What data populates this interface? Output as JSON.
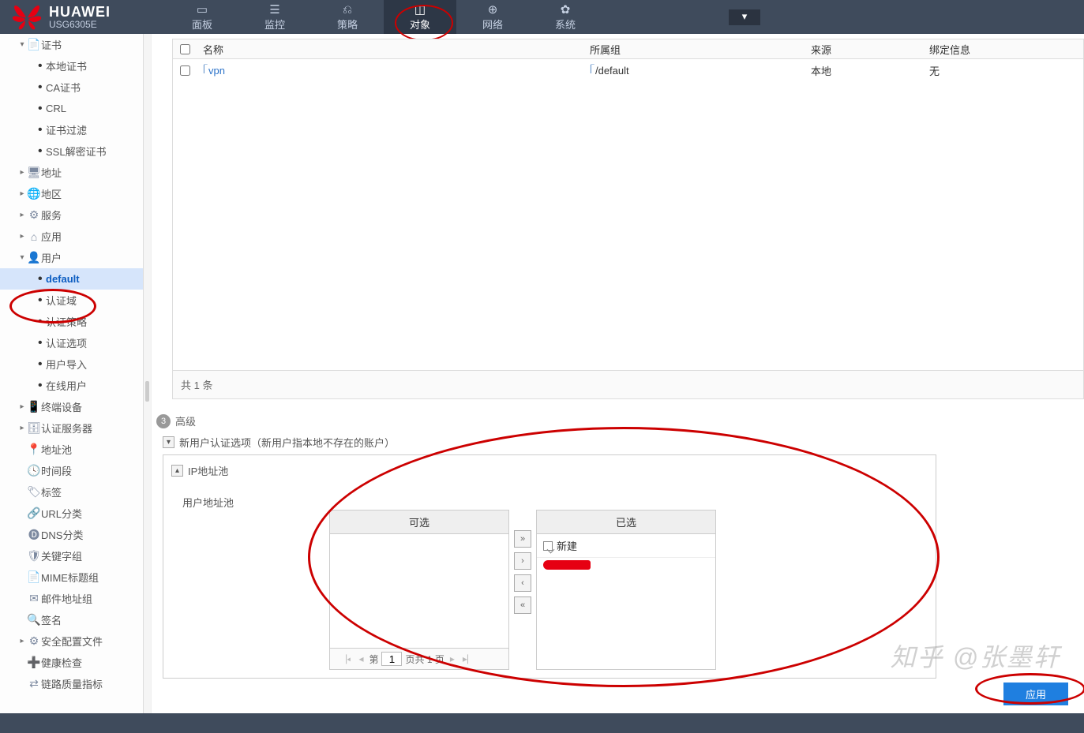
{
  "brand": {
    "name": "HUAWEI",
    "model": "USG6305E"
  },
  "navtabs": [
    {
      "id": "dashboard",
      "label": "面板",
      "icon": "▭"
    },
    {
      "id": "monitor",
      "label": "监控",
      "icon": "☰"
    },
    {
      "id": "policy",
      "label": "策略",
      "icon": "⎌"
    },
    {
      "id": "object",
      "label": "对象",
      "icon": "◫",
      "active": true
    },
    {
      "id": "network",
      "label": "网络",
      "icon": "⊕"
    },
    {
      "id": "system",
      "label": "系统",
      "icon": "✿"
    }
  ],
  "sidebar": [
    {
      "label": "证书",
      "lvl": 0,
      "open": true,
      "icon": "📄"
    },
    {
      "label": "本地证书",
      "lvl": 2
    },
    {
      "label": "CA证书",
      "lvl": 2
    },
    {
      "label": "CRL",
      "lvl": 2
    },
    {
      "label": "证书过滤",
      "lvl": 2
    },
    {
      "label": "SSL解密证书",
      "lvl": 2
    },
    {
      "label": "地址",
      "lvl": 0,
      "closed": true,
      "icon": "🖥"
    },
    {
      "label": "地区",
      "lvl": 0,
      "closed": true,
      "icon": "🌐"
    },
    {
      "label": "服务",
      "lvl": 0,
      "closed": true,
      "icon": "⚙"
    },
    {
      "label": "应用",
      "lvl": 0,
      "closed": true,
      "icon": "⌂"
    },
    {
      "label": "用户",
      "lvl": 0,
      "open": true,
      "icon": "👤"
    },
    {
      "label": "default",
      "lvl": 2,
      "selected": true
    },
    {
      "label": "认证域",
      "lvl": 2
    },
    {
      "label": "认证策略",
      "lvl": 2
    },
    {
      "label": "认证选项",
      "lvl": 2
    },
    {
      "label": "用户导入",
      "lvl": 2
    },
    {
      "label": "在线用户",
      "lvl": 2
    },
    {
      "label": "终端设备",
      "lvl": 0,
      "closed": true,
      "icon": "📱"
    },
    {
      "label": "认证服务器",
      "lvl": 0,
      "closed": true,
      "icon": "🗄"
    },
    {
      "label": "地址池",
      "lvl": 0,
      "leaf": true,
      "icon": "📍"
    },
    {
      "label": "时间段",
      "lvl": 0,
      "leaf": true,
      "icon": "🕓"
    },
    {
      "label": "标签",
      "lvl": 0,
      "leaf": true,
      "icon": "🏷"
    },
    {
      "label": "URL分类",
      "lvl": 0,
      "leaf": true,
      "icon": "🔗"
    },
    {
      "label": "DNS分类",
      "lvl": 0,
      "leaf": true,
      "icon": "🅓"
    },
    {
      "label": "关键字组",
      "lvl": 0,
      "leaf": true,
      "icon": "🛡"
    },
    {
      "label": "MIME标题组",
      "lvl": 0,
      "leaf": true,
      "icon": "📄"
    },
    {
      "label": "邮件地址组",
      "lvl": 0,
      "leaf": true,
      "icon": "✉"
    },
    {
      "label": "签名",
      "lvl": 0,
      "leaf": true,
      "icon": "🔍"
    },
    {
      "label": "安全配置文件",
      "lvl": 0,
      "closed": true,
      "icon": "⚙"
    },
    {
      "label": "健康检查",
      "lvl": 0,
      "leaf": true,
      "icon": "➕"
    },
    {
      "label": "链路质量指标",
      "lvl": 0,
      "leaf": true,
      "icon": "⇄"
    }
  ],
  "table": {
    "headers": {
      "name": "名称",
      "group": "所属组",
      "src": "来源",
      "bind": "绑定信息"
    },
    "rows": [
      {
        "name": "vpn",
        "group": "/default",
        "src": "本地",
        "bind": "无"
      }
    ],
    "footer": "共 1 条"
  },
  "step3": {
    "num": "3",
    "label": "高级"
  },
  "newUserOption": {
    "label": "新用户认证选项（新用户指本地不存在的账户）"
  },
  "ipPool": {
    "title": "IP地址池",
    "fieldLabel": "用户地址池",
    "available": "可选",
    "chosen": "已选",
    "newBtn": "新建",
    "pager": {
      "prefix": "第",
      "page": "1",
      "middle": "页共 1 页"
    }
  },
  "applyBtn": "应用",
  "watermark": "知乎 @张墨轩",
  "footerText": ""
}
